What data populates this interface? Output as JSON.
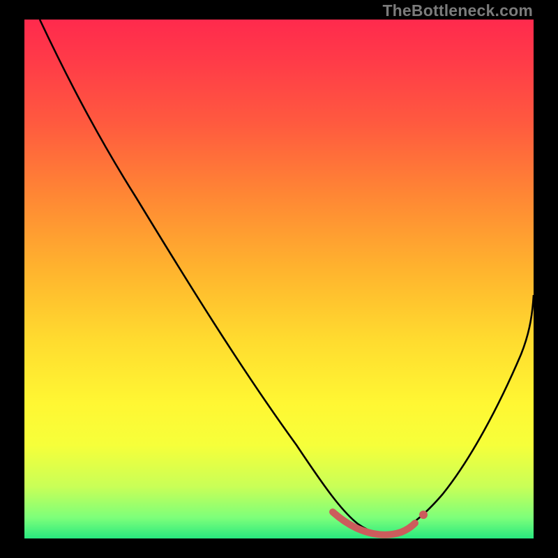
{
  "watermark": "TheBottleneck.com",
  "chart_data": {
    "type": "line",
    "title": "",
    "xlabel": "",
    "ylabel": "",
    "xlim": [
      0,
      100
    ],
    "ylim": [
      0,
      100
    ],
    "background_gradient": {
      "stops": [
        {
          "pos": 0,
          "color": "#ff2a4d"
        },
        {
          "pos": 8,
          "color": "#ff3b48"
        },
        {
          "pos": 20,
          "color": "#ff5a3f"
        },
        {
          "pos": 34,
          "color": "#ff8734"
        },
        {
          "pos": 48,
          "color": "#ffb32e"
        },
        {
          "pos": 62,
          "color": "#ffdc2f"
        },
        {
          "pos": 74,
          "color": "#fff733"
        },
        {
          "pos": 82,
          "color": "#f6ff3a"
        },
        {
          "pos": 90,
          "color": "#c9ff57"
        },
        {
          "pos": 96,
          "color": "#7dff7a"
        },
        {
          "pos": 100,
          "color": "#28e97f"
        }
      ]
    },
    "series": [
      {
        "name": "bottleneck-curve",
        "color": "#000000",
        "points": [
          {
            "x": 3,
            "y": 100
          },
          {
            "x": 10,
            "y": 86
          },
          {
            "x": 20,
            "y": 70
          },
          {
            "x": 30,
            "y": 53
          },
          {
            "x": 40,
            "y": 37
          },
          {
            "x": 50,
            "y": 20
          },
          {
            "x": 58,
            "y": 7
          },
          {
            "x": 62,
            "y": 3
          },
          {
            "x": 66,
            "y": 1
          },
          {
            "x": 70,
            "y": 1
          },
          {
            "x": 74,
            "y": 2
          },
          {
            "x": 78,
            "y": 4
          },
          {
            "x": 85,
            "y": 13
          },
          {
            "x": 92,
            "y": 28
          },
          {
            "x": 100,
            "y": 47
          }
        ]
      },
      {
        "name": "highlight-segment",
        "color": "#cc5c5c",
        "points": [
          {
            "x": 60,
            "y": 5
          },
          {
            "x": 63,
            "y": 2.5
          },
          {
            "x": 66,
            "y": 1.5
          },
          {
            "x": 69,
            "y": 1.2
          },
          {
            "x": 72,
            "y": 1.6
          },
          {
            "x": 75,
            "y": 2.8
          }
        ]
      }
    ],
    "markers": [
      {
        "name": "highlight-end-dot",
        "x": 77,
        "y": 4,
        "color": "#cc5c5c"
      }
    ]
  }
}
